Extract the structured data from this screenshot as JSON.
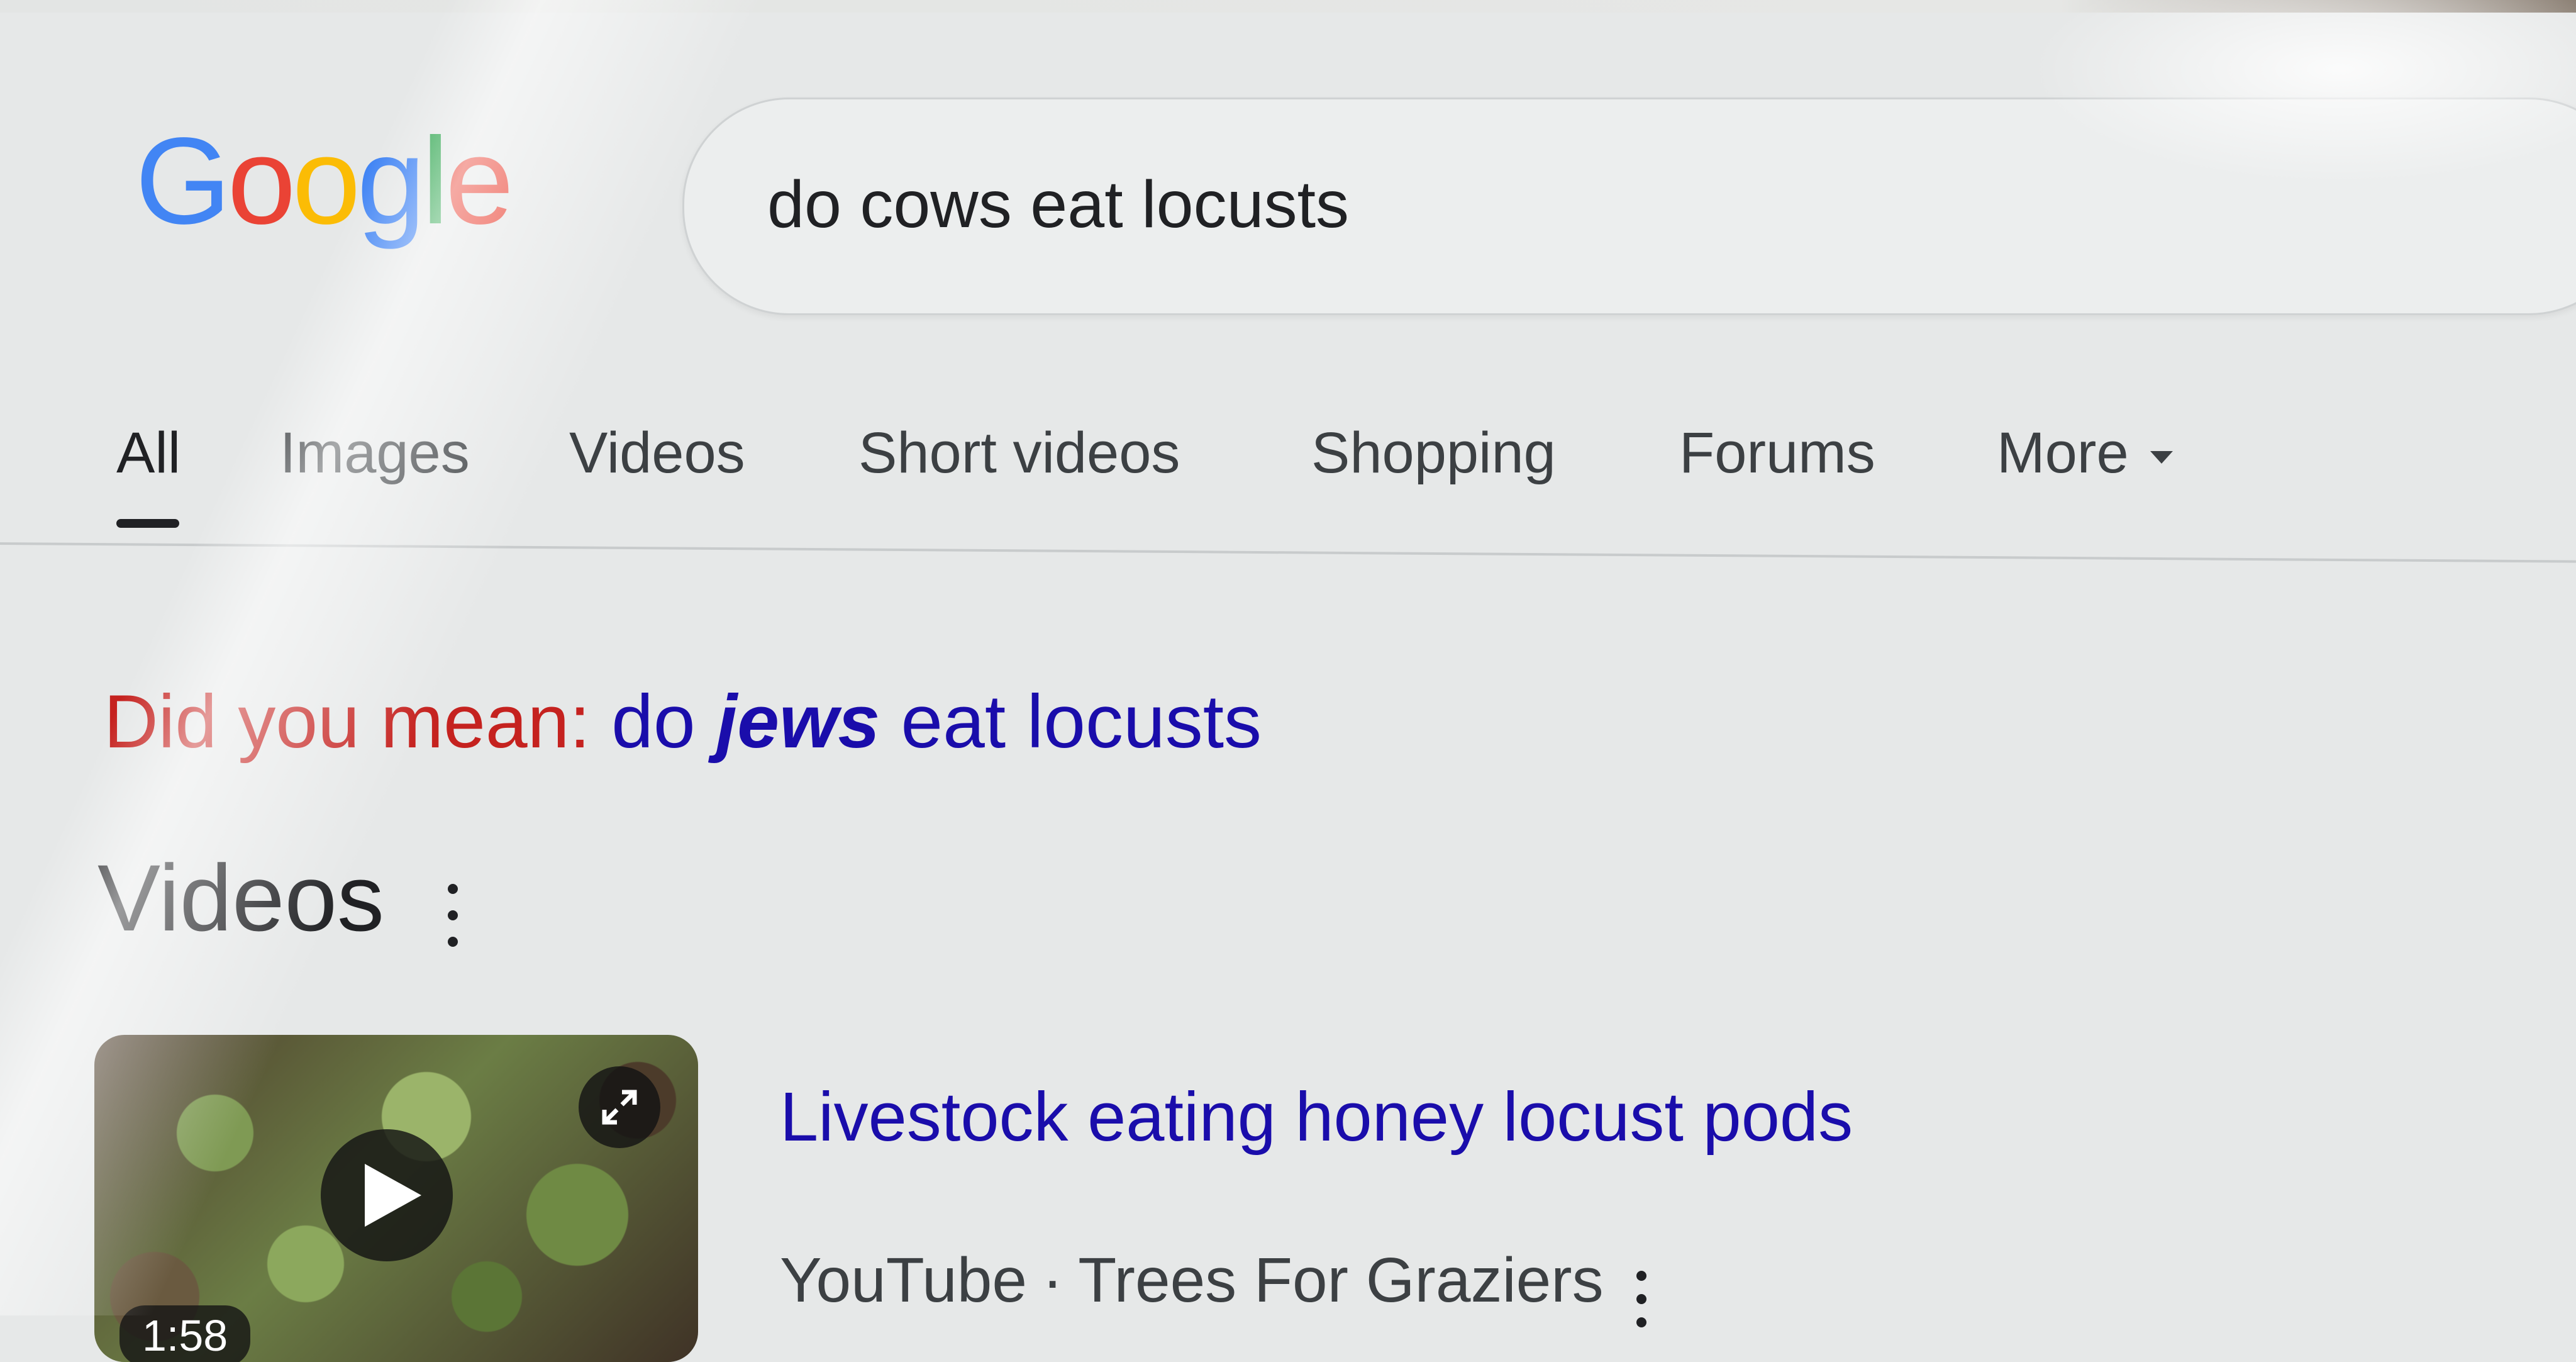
{
  "logo": {
    "letters": [
      "G",
      "o",
      "o",
      "g",
      "l",
      "e"
    ],
    "colors": [
      "#4285F4",
      "#EA4335",
      "#FBBC05",
      "#4285F4",
      "#34A853",
      "#EA4335"
    ]
  },
  "search": {
    "query": "do cows eat locusts"
  },
  "tabs": [
    {
      "label": "All",
      "active": true
    },
    {
      "label": "Images"
    },
    {
      "label": "Videos"
    },
    {
      "label": "Short videos"
    },
    {
      "label": "Shopping"
    },
    {
      "label": "Forums"
    },
    {
      "label": "More"
    }
  ],
  "did_you_mean": {
    "prefix": "Did you mean:",
    "before": "do",
    "emphasis": "jews",
    "after": "eat locusts"
  },
  "videos_section": {
    "heading": "Videos",
    "items": [
      {
        "title": "Livestock eating honey locust pods",
        "source": "YouTube",
        "separator": "·",
        "channel": "Trees For Graziers",
        "duration": "1:58"
      }
    ]
  },
  "icons": {
    "play": "play-icon",
    "expand": "expand-icon",
    "more_tabs": "caret-down-icon",
    "menu": "more-vert-icon"
  },
  "colors": {
    "link": "#1a0dab",
    "did_you_mean_prefix": "#c5221f",
    "text": "#202124"
  }
}
